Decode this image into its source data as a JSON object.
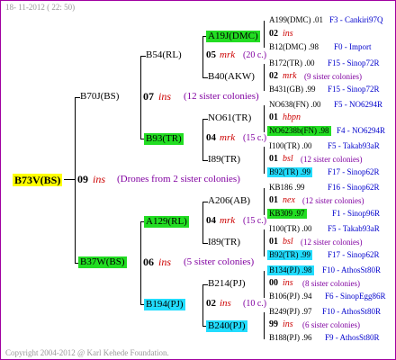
{
  "header": {
    "date": "18- 11-2012 ( 22: 50)"
  },
  "footer": {
    "copyright": "Copyright 2004-2012 @ Karl Kehede Foundation."
  },
  "colors": {
    "border": "#a000a0",
    "green": "#22dd22",
    "cyan": "#22ddff",
    "yellow": "#ffff00",
    "red": "#cc0000",
    "blue": "#0000cc",
    "purple": "#8000a0"
  },
  "root": {
    "name": "B73V(BS)",
    "gen": "09",
    "sym": "ins",
    "note": "(Drones from 2 sister colonies)"
  },
  "gen2": {
    "top": {
      "name": "B70J(BS)",
      "gen": "07",
      "sym": "ins",
      "note": "(12 sister colonies)"
    },
    "bottom": {
      "name": "B37W(BS)",
      "gen": "06",
      "sym": "ins",
      "note": "(5 sister colonies)"
    }
  },
  "gen3": {
    "a": {
      "name": "B54(RL)",
      "gen": "05",
      "sym": "mrk",
      "note": "(20 c.)"
    },
    "b": {
      "name": "B93(TR)",
      "gen": "04",
      "sym": "mrk",
      "note": "(15 c.)"
    },
    "c": {
      "name": "A129(RL)",
      "gen": "04",
      "sym": "mrk",
      "note": "(15 c.)"
    },
    "d": {
      "name": "B194(PJ)",
      "gen": "02",
      "sym": "ins",
      "note": "(10 c.)"
    }
  },
  "gen4": {
    "a1": "A19J(DMC)",
    "a2": "B40(AKW)",
    "b1": "NO61(TR)",
    "b2": "I89(TR)",
    "c1": "A206(AB)",
    "c2": "I89(TR)",
    "d1": "B214(PJ)",
    "d2": "B240(PJ)"
  },
  "gen5": [
    {
      "top": "A199(DMC) .01",
      "topR": "F3 - Cankiri97Q",
      "gen": "02",
      "sym": "ins",
      "note": "",
      "bot": "B12(DMC) .98",
      "botR": "F0 - Import"
    },
    {
      "top": "B172(TR) .00",
      "topR": "F15 - Sinop72R",
      "gen": "02",
      "sym": "mrk",
      "note": "(9 sister colonies)",
      "bot": "B431(GB) .99",
      "botR": "F15 - Sinop72R"
    },
    {
      "top": "NO638(FN) .00",
      "topR": "F5 - NO6294R",
      "gen": "01",
      "sym": "hbpn",
      "note": "",
      "bot": "NO6238b(FN) .98",
      "botR": "F4 - NO6294R"
    },
    {
      "top": "I100(TR) .00",
      "topR": "F5 - Takab93aR",
      "gen": "01",
      "sym": "bsl",
      "note": "(12 sister colonies)",
      "bot": "B92(TR) .99",
      "botR": "F17 - Sinop62R"
    },
    {
      "top": "KB186 .99",
      "topR": "F16 - Sinop62R",
      "gen": "01",
      "sym": "nex",
      "note": "(12 sister colonies)",
      "bot": "KB309 .97",
      "botR": "F1 - Sinop96R"
    },
    {
      "top": "I100(TR) .00",
      "topR": "F5 - Takab93aR",
      "gen": "01",
      "sym": "bsl",
      "note": "(12 sister colonies)",
      "bot": "B92(TR) .99",
      "botR": "F17 - Sinop62R"
    },
    {
      "top": "B134(PJ) .98",
      "topR": "F10 - AthosSt80R",
      "gen": "00",
      "sym": "ins",
      "note": "(8 sister colonies)",
      "bot": "B106(PJ) .94",
      "botR": "F6 - SinopEgg86R"
    },
    {
      "top": "B249(PJ) .97",
      "topR": "F10 - AthosSt80R",
      "gen": "99",
      "sym": "ins",
      "note": "(6 sister colonies)",
      "bot": "B188(PJ) .96",
      "botR": "F9 - AthosSt80R"
    }
  ]
}
